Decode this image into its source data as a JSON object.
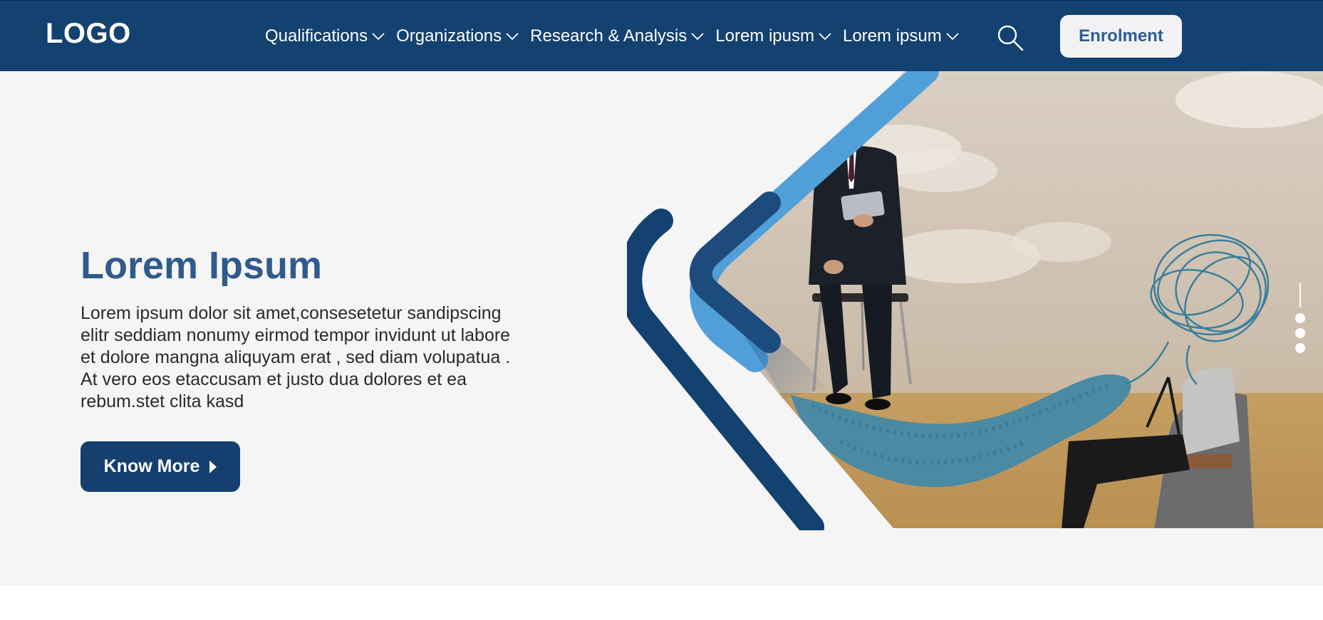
{
  "header": {
    "logo": "LOGO",
    "nav": [
      {
        "label": "Qualifications"
      },
      {
        "label": "Organizations"
      },
      {
        "label": "Research & Analysis"
      },
      {
        "label": "Lorem ipusm"
      },
      {
        "label": "Lorem ipsum"
      }
    ],
    "search_icon": "search-icon",
    "enrol_label": "Enrolment"
  },
  "hero": {
    "title": "Lorem Ipsum",
    "lines": [
      "Lorem ipsum dolor sit amet,consesetetur sandipscing",
      "elitr seddiam nonumy eirmod tempor invidunt ut labore",
      "et dolore mangna aliquyam erat , sed diam volupatua .",
      "At vero eos etaccusam et justo dua dolores et ea",
      "rebum.stet clita kasd"
    ],
    "button_label": "Know More",
    "slider_dots": 3
  },
  "colors": {
    "header_bg": "#134170",
    "accent_light_blue": "#519fd8",
    "accent_dark_blue": "#134170",
    "title_blue": "#2f5b8c",
    "hero_bg": "#f5f5f6"
  }
}
